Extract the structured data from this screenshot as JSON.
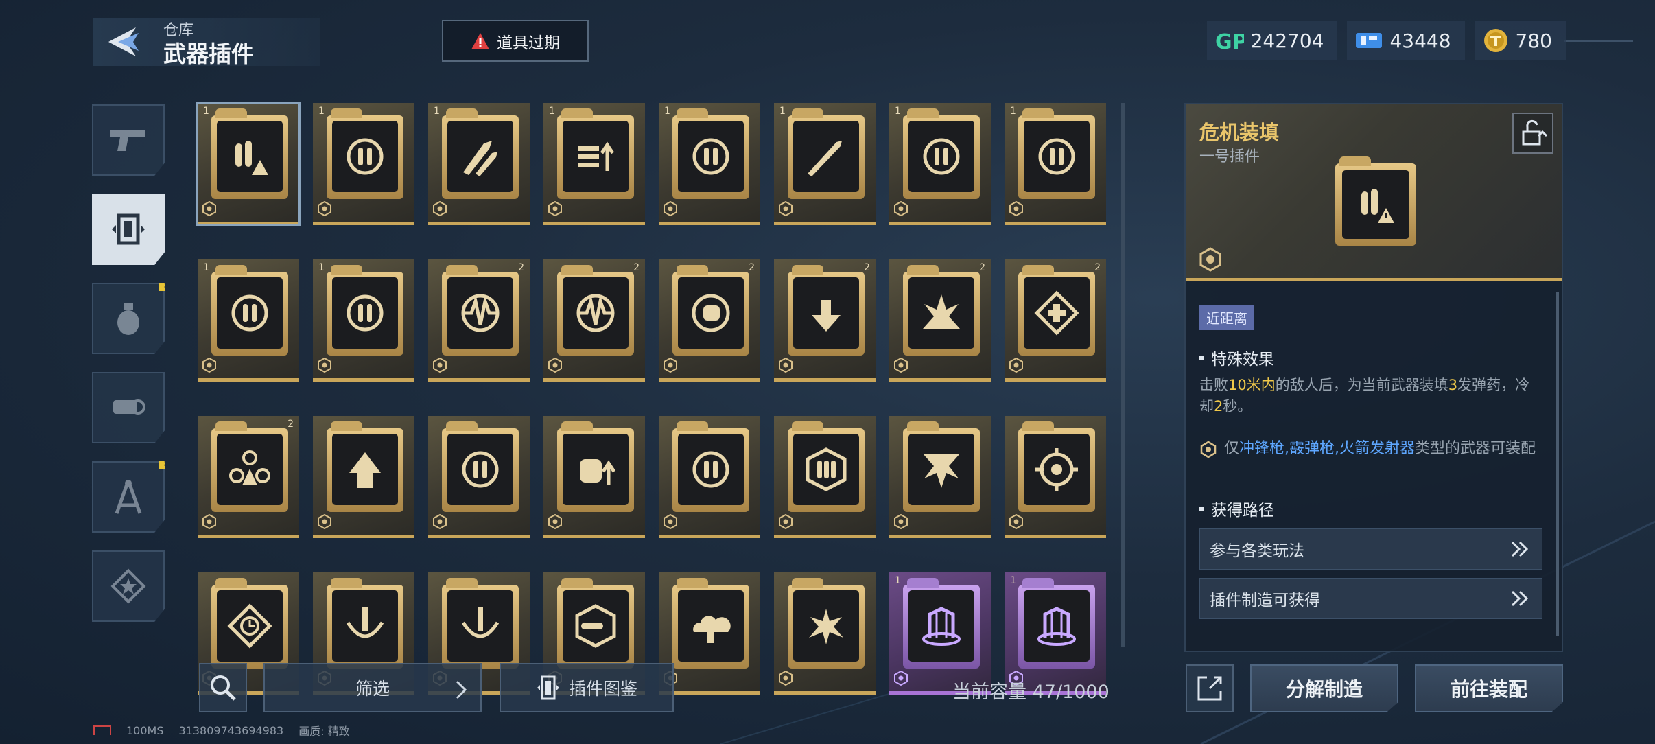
{
  "header": {
    "subtitle": "仓库",
    "title": "武器插件"
  },
  "expire_button": {
    "label": "道具过期"
  },
  "currencies": [
    {
      "icon": "gp-icon",
      "value": "242704"
    },
    {
      "icon": "ticket-icon",
      "value": "43448"
    },
    {
      "icon": "gold-coin-icon",
      "value": "780"
    }
  ],
  "side_tabs": [
    {
      "icon": "pistol-icon",
      "active": false,
      "badge": ""
    },
    {
      "icon": "plugin-icon",
      "active": true,
      "badge": ""
    },
    {
      "icon": "grenade-icon",
      "active": false,
      "badge": "!"
    },
    {
      "icon": "gear-hand-icon",
      "active": false,
      "badge": ""
    },
    {
      "icon": "compass-tool-icon",
      "active": false,
      "badge": "!"
    },
    {
      "icon": "star-badge-icon",
      "active": false,
      "badge": ""
    }
  ],
  "grid_items": [
    {
      "icon": "ammo-warning-icon",
      "num": "1",
      "tag": "",
      "rarity": "gold",
      "selected": true
    },
    {
      "icon": "crosshair-ammo-icon",
      "num": "1",
      "tag": "",
      "rarity": "gold"
    },
    {
      "icon": "rockets-icon",
      "num": "1",
      "tag": "",
      "rarity": "gold"
    },
    {
      "icon": "bullets-up-icon",
      "num": "1",
      "tag": "",
      "rarity": "gold"
    },
    {
      "icon": "target-up-icon",
      "num": "1",
      "tag": "",
      "rarity": "gold"
    },
    {
      "icon": "missiles-icon",
      "num": "1",
      "tag": "",
      "rarity": "gold"
    },
    {
      "icon": "reload-gear-icon",
      "num": "1",
      "tag": "",
      "rarity": "gold"
    },
    {
      "icon": "wave-ammo-icon",
      "num": "1",
      "tag": "",
      "rarity": "gold"
    },
    {
      "icon": "wave-ammo-icon",
      "num": "1",
      "tag": "",
      "rarity": "gold"
    },
    {
      "icon": "wave-ammo-icon",
      "num": "1",
      "tag": "",
      "rarity": "gold"
    },
    {
      "icon": "pulse-icon",
      "num": "",
      "tag": "2",
      "rarity": "gold"
    },
    {
      "icon": "pulse-icon",
      "num": "",
      "tag": "2",
      "rarity": "gold"
    },
    {
      "icon": "fist-cycle-icon",
      "num": "",
      "tag": "2",
      "rarity": "gold"
    },
    {
      "icon": "heal-down-icon",
      "num": "",
      "tag": "2",
      "rarity": "gold"
    },
    {
      "icon": "burst-icon",
      "num": "",
      "tag": "2",
      "rarity": "gold"
    },
    {
      "icon": "medkit-diamond-icon",
      "num": "",
      "tag": "2",
      "rarity": "gold"
    },
    {
      "icon": "triad-icon",
      "num": "",
      "tag": "2",
      "rarity": "gold"
    },
    {
      "icon": "arrows-up-icon",
      "num": "",
      "tag": "",
      "rarity": "gold"
    },
    {
      "icon": "crosshair-up-icon",
      "num": "",
      "tag": "",
      "rarity": "gold"
    },
    {
      "icon": "fist-up-icon",
      "num": "",
      "tag": "",
      "rarity": "gold"
    },
    {
      "icon": "target-pin-icon",
      "num": "",
      "tag": "",
      "rarity": "gold"
    },
    {
      "icon": "shield-ammo-icon",
      "num": "",
      "tag": "",
      "rarity": "gold"
    },
    {
      "icon": "burst-down-icon",
      "num": "",
      "tag": "",
      "rarity": "gold"
    },
    {
      "icon": "reticle-icon",
      "num": "",
      "tag": "",
      "rarity": "gold"
    },
    {
      "icon": "clock-diamond-icon",
      "num": "",
      "tag": "",
      "rarity": "gold"
    },
    {
      "icon": "splash-up-icon",
      "num": "",
      "tag": "",
      "rarity": "gold"
    },
    {
      "icon": "splash-up-icon",
      "num": "",
      "tag": "",
      "rarity": "gold"
    },
    {
      "icon": "hex-bullet-icon",
      "num": "",
      "tag": "",
      "rarity": "gold"
    },
    {
      "icon": "explosion-cloud-icon",
      "num": "",
      "tag": "",
      "rarity": "gold"
    },
    {
      "icon": "shatter-icon",
      "num": "",
      "tag": "",
      "rarity": "gold"
    },
    {
      "icon": "energy-shield-icon",
      "num": "1",
      "tag": "",
      "rarity": "purple"
    },
    {
      "icon": "energy-shield-icon",
      "num": "1",
      "tag": "",
      "rarity": "purple"
    }
  ],
  "bottom": {
    "filter_label": "筛选",
    "catalog_label": "插件图鉴",
    "capacity_label": "当前容量 47/1000",
    "status_ping": "100MS",
    "status_id": "313809743694983",
    "status_quality": "画质: 精致"
  },
  "detail": {
    "name": "危机装填",
    "type": "一号插件",
    "range_tag": "近距离",
    "effect_title": "特殊效果",
    "effect_parts": [
      "击败",
      "10米内",
      "的敌人后，为当前武器装填",
      "3",
      "发弹药，冷却",
      "2",
      "秒。"
    ],
    "weapon_parts": [
      "仅",
      "冲锋枪,霰弹枪,火箭发射器",
      "类型的武器可装配"
    ],
    "source_title": "获得路径",
    "sources": [
      "参与各类玩法",
      "插件制造可获得"
    ]
  },
  "actions": {
    "dismantle": "分解制造",
    "equip": "前往装配"
  },
  "colors": {
    "accent_gold": "#e9c56b",
    "highlight_yellow": "#f0c94a",
    "weapon_blue": "#5ea7ff",
    "warning_red": "#e04040",
    "rarity_purple": "#a874d6"
  }
}
